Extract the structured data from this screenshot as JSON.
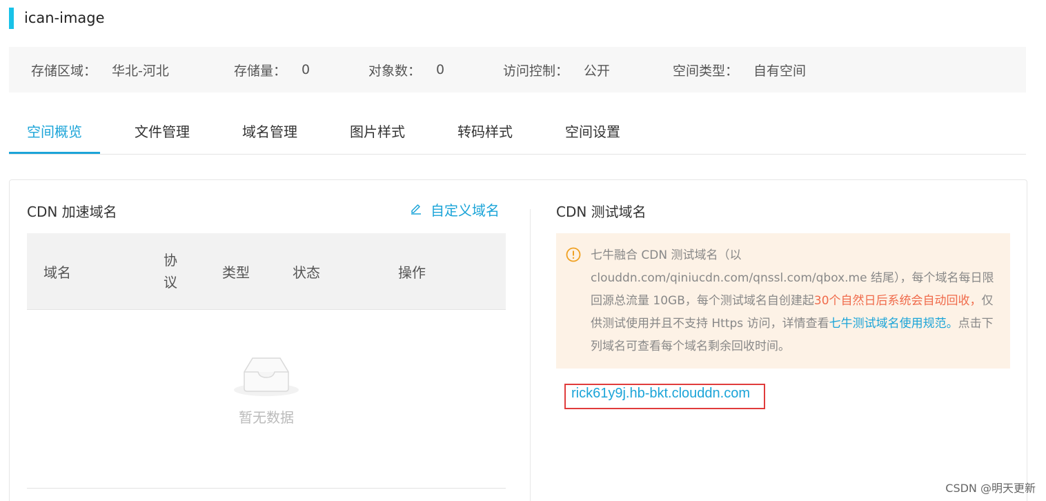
{
  "bucket": {
    "name": "ican-image"
  },
  "info": {
    "region_label": "存储区域：",
    "region_value": "华北-河北",
    "storage_label": "存储量：",
    "storage_value": "0",
    "objects_label": "对象数：",
    "objects_value": "0",
    "access_label": "访问控制：",
    "access_value": "公开",
    "type_label": "空间类型：",
    "type_value": "自有空间"
  },
  "tabs": [
    {
      "label": "空间概览",
      "active": true
    },
    {
      "label": "文件管理"
    },
    {
      "label": "域名管理"
    },
    {
      "label": "图片样式"
    },
    {
      "label": "转码样式"
    },
    {
      "label": "空间设置"
    }
  ],
  "cdn_section": {
    "title": "CDN 加速域名",
    "custom_domain_label": "自定义域名",
    "columns": {
      "domain": "域名",
      "protocol_1": "协",
      "protocol_2": "议",
      "type": "类型",
      "status": "状态",
      "action": "操作"
    },
    "empty_text": "暂无数据"
  },
  "test_section": {
    "title": "CDN 测试域名",
    "notice": {
      "part1": "七牛融合 CDN 测试域名（以 clouddn.com/qiniucdn.com/qnssl.com/qbox.me 结尾），每个域名每日限回源总流量 10GB，每个测试域名自创建起",
      "highlight": "30个自然日后系统会自动回收，",
      "part2": "仅供测试使用并且不支持 Https 访问，详情查看",
      "link": "七牛测试域名使用规范。",
      "part3": "点击下列域名可查看每个域名剩余回收时间。"
    },
    "domain": "rick61y9j.hb-bkt.clouddn.com"
  },
  "watermark": "CSDN @明天更新",
  "colors": {
    "accent": "#1ba4d8",
    "title_bar": "#19c2e8",
    "warning_bg": "#fdf2e6",
    "warning_icon": "#f0a020",
    "highlight_red": "#f06a4a",
    "box_red": "#e03b3b"
  }
}
